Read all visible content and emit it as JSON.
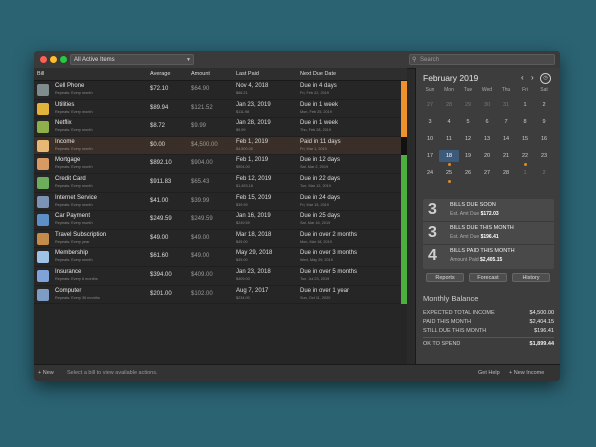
{
  "toolbar": {
    "filter": "All Active Items",
    "search_placeholder": "Search"
  },
  "columns": {
    "bill": "Bill",
    "average": "Average",
    "amount": "Amount",
    "last_paid": "Last Paid",
    "next_due": "Next Due Date"
  },
  "bills": [
    {
      "name": "Cell Phone",
      "repeat": "Repeats: Every month",
      "average": "$72.10",
      "amount": "$64.90",
      "last_paid": "Nov 4, 2018",
      "last_paid_sub": "$68.21",
      "next_due": "Due in 4 days",
      "next_due_sub": "Fri, Feb 22, 2019",
      "status_color": "#f0922b",
      "icon_color": "#7f8c8d"
    },
    {
      "name": "Utilities",
      "repeat": "Repeats: Every month",
      "average": "$89.94",
      "amount": "$121.52",
      "last_paid": "Jan 23, 2019",
      "last_paid_sub": "$111.98",
      "next_due": "Due in 1 week",
      "next_due_sub": "Mon, Feb 25, 2019",
      "status_color": "#f0922b",
      "icon_color": "#e2b33a"
    },
    {
      "name": "Netflix",
      "repeat": "Repeats: Every month",
      "average": "$8.72",
      "amount": "$9.99",
      "last_paid": "Jan 28, 2019",
      "last_paid_sub": "$9.99",
      "next_due": "Due in 1 week",
      "next_due_sub": "Thu, Feb 28, 2019",
      "status_color": "#f0922b",
      "icon_color": "#8db04a"
    },
    {
      "name": "Income",
      "repeat": "Repeats: Every month",
      "average": "$0.00",
      "amount": "$4,500.00",
      "last_paid": "Feb 1, 2019",
      "last_paid_sub": "$4,500.00",
      "next_due": "Paid in 11 days",
      "next_due_sub": "Fri, Mar 1, 2019",
      "status_color": "#111111",
      "icon_color": "#e7b873"
    },
    {
      "name": "Mortgage",
      "repeat": "Repeats: Every month",
      "average": "$892.10",
      "amount": "$904.00",
      "last_paid": "Feb 1, 2019",
      "last_paid_sub": "$904.00",
      "next_due": "Due in 12 days",
      "next_due_sub": "Sat, Mar 2, 2019",
      "status_color": "#4caf3e",
      "icon_color": "#d89a63"
    },
    {
      "name": "Credit Card",
      "repeat": "Repeats: Every month",
      "average": "$911.83",
      "amount": "$65.43",
      "last_paid": "Feb 12, 2019",
      "last_paid_sub": "$1,453.18",
      "next_due": "Due in 22 days",
      "next_due_sub": "Tue, Mar 12, 2019",
      "status_color": "#4caf3e",
      "icon_color": "#6cae5b"
    },
    {
      "name": "Internet Service",
      "repeat": "Repeats: Every month",
      "average": "$41.00",
      "amount": "$39.99",
      "last_paid": "Feb 15, 2019",
      "last_paid_sub": "$39.99",
      "next_due": "Due in 24 days",
      "next_due_sub": "Fri, Mar 15, 2019",
      "status_color": "#4caf3e",
      "icon_color": "#7c93b6"
    },
    {
      "name": "Car Payment",
      "repeat": "Repeats: Every month",
      "average": "$249.59",
      "amount": "$249.59",
      "last_paid": "Jan 16, 2019",
      "last_paid_sub": "$249.59",
      "next_due": "Due in 25 days",
      "next_due_sub": "Sat, Mar 16, 2019",
      "status_color": "#4caf3e",
      "icon_color": "#5d8fc9"
    },
    {
      "name": "Travel Subscription",
      "repeat": "Repeats: Every year",
      "average": "$49.00",
      "amount": "$49.00",
      "last_paid": "Mar 18, 2018",
      "last_paid_sub": "$49.00",
      "next_due": "Due in over 2 months",
      "next_due_sub": "Mon, Mar 18, 2019",
      "status_color": "#4caf3e",
      "icon_color": "#c58b49"
    },
    {
      "name": "Membership",
      "repeat": "Repeats: Every month",
      "average": "$61.60",
      "amount": "$49.00",
      "last_paid": "May 29, 2018",
      "last_paid_sub": "$49.00",
      "next_due": "Due in over 3 months",
      "next_due_sub": "Wed, May 29, 2019",
      "status_color": "#4caf3e",
      "icon_color": "#9ec3e6"
    },
    {
      "name": "Insurance",
      "repeat": "Repeats: Every 6 months",
      "average": "$394.00",
      "amount": "$409.00",
      "last_paid": "Jan 23, 2018",
      "last_paid_sub": "$409.00",
      "next_due": "Due in over 5 months",
      "next_due_sub": "Tue, Jul 23, 2019",
      "status_color": "#4caf3e",
      "icon_color": "#7fa3d8"
    },
    {
      "name": "Computer",
      "repeat": "Repeats: Every 36 months",
      "average": "$201.00",
      "amount": "$102.00",
      "last_paid": "Aug 7, 2017",
      "last_paid_sub": "$234.00",
      "next_due": "Due in over 1 year",
      "next_due_sub": "Sun, Oct 11, 2020",
      "status_color": "#4caf3e",
      "icon_color": "#7f9cc5"
    }
  ],
  "bottom": {
    "new": "+ New",
    "hint": "Select a bill to view available actions.",
    "help": "Get Help",
    "new_income": "+ New Income"
  },
  "calendar": {
    "month": "February 2019",
    "dow": [
      "Sun",
      "Mon",
      "Tue",
      "Wed",
      "Thu",
      "Fri",
      "Sat"
    ],
    "weeks": [
      [
        "27",
        "28",
        "29",
        "30",
        "31",
        "1",
        "2"
      ],
      [
        "3",
        "4",
        "5",
        "6",
        "7",
        "8",
        "9"
      ],
      [
        "10",
        "11",
        "12",
        "13",
        "14",
        "15",
        "16"
      ],
      [
        "17",
        "18",
        "19",
        "20",
        "21",
        "22",
        "23"
      ],
      [
        "24",
        "25",
        "26",
        "27",
        "28",
        "1",
        "2"
      ]
    ]
  },
  "summary": [
    {
      "count": "3",
      "title": "BILLS DUE SOON",
      "label": "Est. Amt Due",
      "value": "$172.03"
    },
    {
      "count": "3",
      "title": "BILLS DUE THIS MONTH",
      "label": "Est. Amt Due",
      "value": "$196.41"
    },
    {
      "count": "4",
      "title": "BILLS PAID THIS MONTH",
      "label": "Amount Paid",
      "value": "$2,405.15"
    }
  ],
  "actions": {
    "reports": "Reports",
    "forecast": "Forecast",
    "history": "History"
  },
  "balance": {
    "title": "Monthly Balance",
    "rows": [
      {
        "label": "EXPECTED TOTAL INCOME",
        "value": "$4,500.00"
      },
      {
        "label": "PAID THIS MONTH",
        "value": "$2,404.15"
      },
      {
        "label": "STILL DUE THIS MONTH",
        "value": "$196.41"
      },
      {
        "label": "OK TO SPEND",
        "value": "$1,899.44"
      }
    ]
  },
  "colors": {
    "close": "#ff5f57",
    "minimize": "#febc2e",
    "zoom": "#28c840",
    "accent": "#e08a2b"
  }
}
